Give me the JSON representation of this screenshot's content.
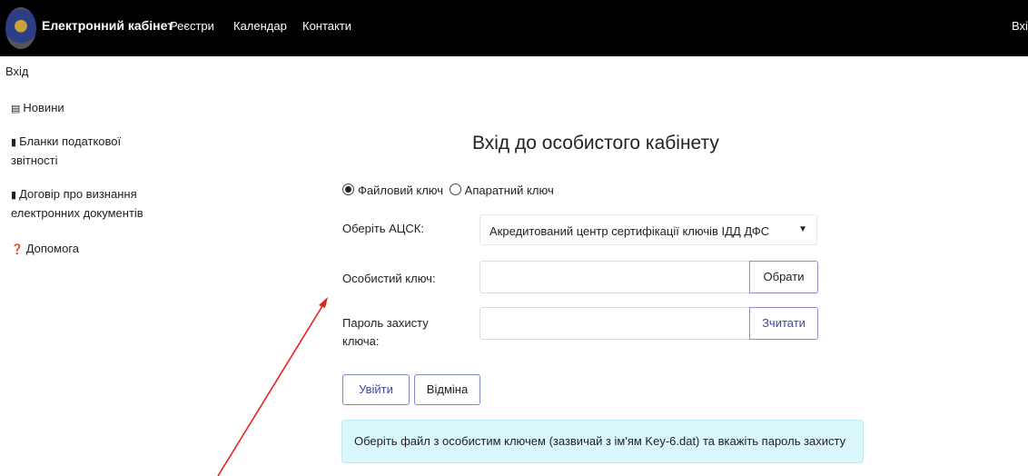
{
  "navbar": {
    "brand": "Електронний кабінет",
    "links": [
      "Реєстри",
      "Календар",
      "Контакти"
    ],
    "right_link": "Вхід"
  },
  "sidebar": {
    "heading": "Вхід",
    "items": [
      {
        "icon": "newspaper-icon",
        "label": "Новини"
      },
      {
        "icon": "book-icon",
        "label": "Бланки податкової звітності"
      },
      {
        "icon": "book-icon",
        "label": "Договір про визнання електронних документів"
      },
      {
        "icon": "question-circle-icon",
        "label": "Допомога"
      }
    ]
  },
  "main": {
    "title": "Вхід до особистого кабінету",
    "key_type": {
      "options": [
        "Файловий ключ",
        "Апаратний ключ"
      ],
      "selected": "Файловий ключ"
    },
    "acsk_label": "Оберіть АЦСК:",
    "acsk_value": "Акредитований центр сертифікації ключів ІДД ДФС",
    "private_key_label": "Особистий ключ:",
    "private_key_value": "",
    "choose_button": "Обрати",
    "password_label_line1": "Пароль захисту",
    "password_label_line2": "ключа:",
    "password_value": "",
    "read_button": "Зчитати",
    "login_button": "Увійти",
    "cancel_button": "Відміна",
    "info_message": "Оберіть файл з особистим ключем (зазвичай з ім'ям Key-6.dat) та вкажіть пароль захисту"
  },
  "colors": {
    "navbar": "#000000",
    "info_bg": "#d9f6fb",
    "button_border": "#7f89c0",
    "annotation_arrow": "#e8201c"
  }
}
